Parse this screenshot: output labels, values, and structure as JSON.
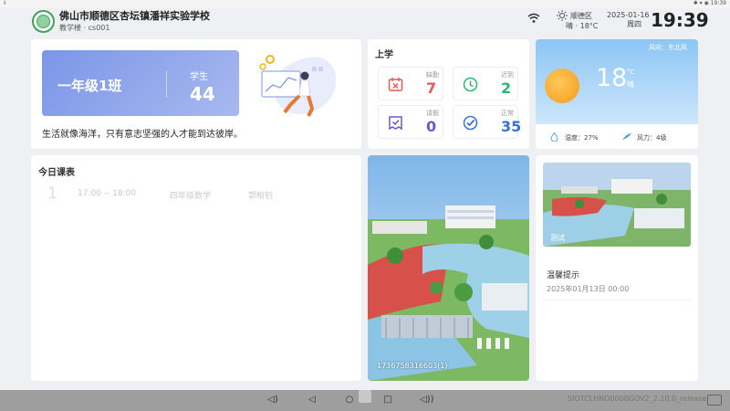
{
  "statusbar": {
    "left_icon": "usb-icon",
    "time": "19:39",
    "icons": [
      "bluetooth-icon",
      "wifi-icon",
      "location-icon"
    ]
  },
  "header": {
    "school_name": "佛山市顺德区杏坛镇潘祥实验学校",
    "building": "教学楼 · cs001",
    "weather_location": "顺德区",
    "weather_condition": "晴 · 18°C",
    "date": "2025-01-16",
    "weekday": "周四",
    "clock": "19:39"
  },
  "class_card": {
    "class_name": "一年级1班",
    "students_label": "学生",
    "students_count": "44",
    "motto": "生活就像海洋，只有意志坚强的人才能到达彼岸。"
  },
  "attendance": {
    "title": "上学",
    "items": [
      {
        "label": "缺勤",
        "value": "7",
        "color": "#e85a5a",
        "icon": "absent-icon"
      },
      {
        "label": "迟到",
        "value": "2",
        "color": "#2bb673",
        "icon": "late-clock-icon"
      },
      {
        "label": "请假",
        "value": "0",
        "color": "#6a5acd",
        "icon": "leave-icon"
      },
      {
        "label": "正常",
        "value": "35",
        "color": "#3a6fd8",
        "icon": "check-icon"
      }
    ]
  },
  "weather": {
    "wind_direction": "风向：东北风",
    "temperature": "18",
    "unit": "°C",
    "condition": "晴",
    "humidity": "湿度：27%",
    "wind_power": "风力：4级"
  },
  "schedule": {
    "title": "今日课表",
    "rows": [
      {
        "num": "1",
        "time": "17:00 -- 18:00",
        "subject": "四年级数学",
        "teacher": "郭柏钊"
      }
    ]
  },
  "photo": {
    "caption": "1736758316603(1)"
  },
  "notice": {
    "image_label": "测试",
    "title": "温馨提示",
    "date": "2025年01月13日 00:00"
  },
  "navbar": {
    "version": "SIOTCLHNO0000GOV2_2.10.0_release",
    "buttons": [
      "volume-down-icon",
      "back-icon",
      "home-icon",
      "recents-icon",
      "volume-up-icon"
    ]
  }
}
